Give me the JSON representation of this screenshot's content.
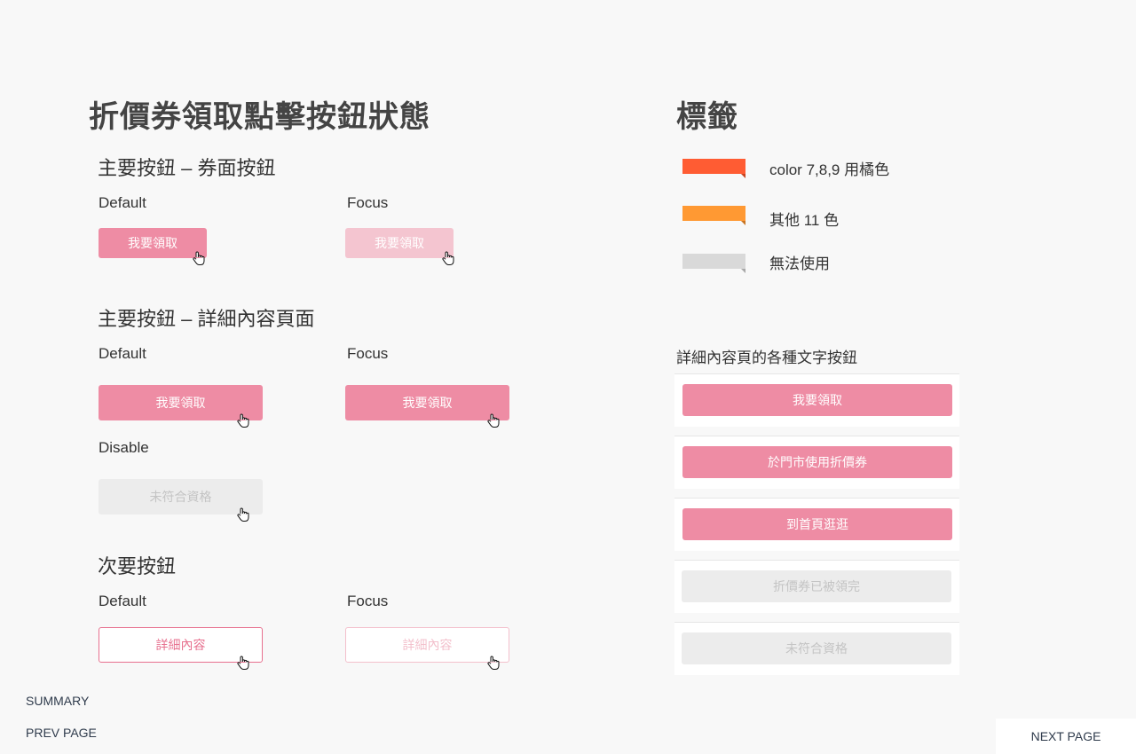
{
  "left": {
    "title": "折價券領取點擊按鈕狀態",
    "primary_coupon": {
      "heading": "主要按鈕 – 券面按鈕",
      "default_label": "Default",
      "focus_label": "Focus",
      "default_btn": "我要領取",
      "focus_btn": "我要領取"
    },
    "primary_detail": {
      "heading": "主要按鈕 – 詳細內容頁面",
      "default_label": "Default",
      "focus_label": "Focus",
      "disable_label": "Disable",
      "default_btn": "我要領取",
      "focus_btn": "我要領取",
      "disable_btn": "未符合資格"
    },
    "secondary": {
      "heading": "次要按鈕",
      "default_label": "Default",
      "focus_label": "Focus",
      "default_btn": "詳細內容",
      "focus_btn": "詳細內容"
    }
  },
  "right": {
    "title": "標籤",
    "tags": [
      {
        "label": "color 7,8,9 用橘色",
        "color": "#ff5c33",
        "fold": "#c8431f"
      },
      {
        "label": "其他 11 色",
        "color": "#ff9933",
        "fold": "#c87422"
      },
      {
        "label": "無法使用",
        "color": "#d9d9d9",
        "fold": "#a8a8a8"
      }
    ],
    "text_buttons_heading": "詳細內容頁的各種文字按鈕",
    "text_buttons": [
      {
        "label": "我要領取",
        "state": "active"
      },
      {
        "label": "於門市使用折價券",
        "state": "active"
      },
      {
        "label": "到首頁逛逛",
        "state": "active"
      },
      {
        "label": "折價券已被領完",
        "state": "disabled"
      },
      {
        "label": "未符合資格",
        "state": "disabled"
      }
    ]
  },
  "nav": {
    "summary": "SUMMARY",
    "prev": "PREV PAGE",
    "next": "NEXT PAGE"
  },
  "colors": {
    "pink": "#ee8ca4",
    "pink_light": "#f4c5d0",
    "disabled_bg": "#ececec",
    "outline_pink": "#e7718f",
    "background": "#f8f8f8"
  }
}
